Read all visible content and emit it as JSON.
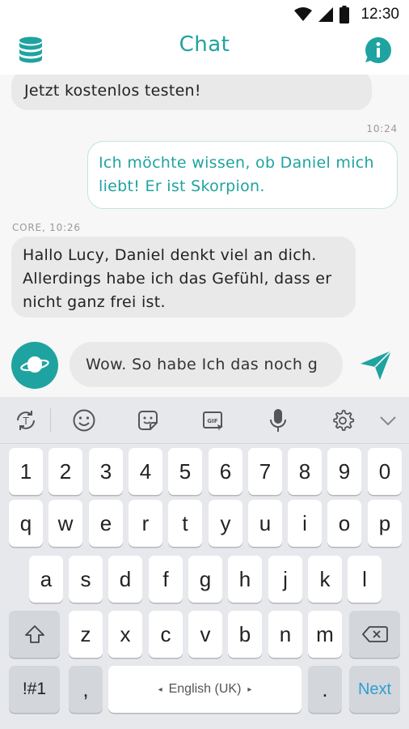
{
  "status_bar": {
    "time": "12:30"
  },
  "header": {
    "title": "Chat"
  },
  "chat": {
    "messages": [
      {
        "from": "core",
        "text": "Jetzt kostenlos testen!"
      },
      {
        "from": "user",
        "timestamp": "10:24",
        "text": "Ich möchte wissen, ob Daniel mich liebt! Er ist Skorpion."
      },
      {
        "from": "core",
        "timestamp": "CORE, 10:26",
        "text": "Hallo Lucy, Daniel denkt viel an dich. Allerdings habe ich das Gefühl, dass er nicht ganz frei ist."
      }
    ]
  },
  "composer": {
    "value": "Wow. So habe Ich das noch g"
  },
  "keyboard": {
    "number_row": [
      "1",
      "2",
      "3",
      "4",
      "5",
      "6",
      "7",
      "8",
      "9",
      "0"
    ],
    "row1": [
      "q",
      "w",
      "e",
      "r",
      "t",
      "y",
      "u",
      "i",
      "o",
      "p"
    ],
    "row2": [
      "a",
      "s",
      "d",
      "f",
      "g",
      "h",
      "j",
      "k",
      "l"
    ],
    "row3": [
      "z",
      "x",
      "c",
      "v",
      "b",
      "n",
      "m"
    ],
    "symbols_label": "!#1",
    "comma": ",",
    "space_label": "English (UK)",
    "period": ".",
    "action_label": "Next"
  },
  "colors": {
    "accent": "#1fa3a0",
    "bubble_gray": "#e9e9e9",
    "keyboard_bg": "#e6e8ec",
    "next_blue": "#2f9fd0"
  }
}
